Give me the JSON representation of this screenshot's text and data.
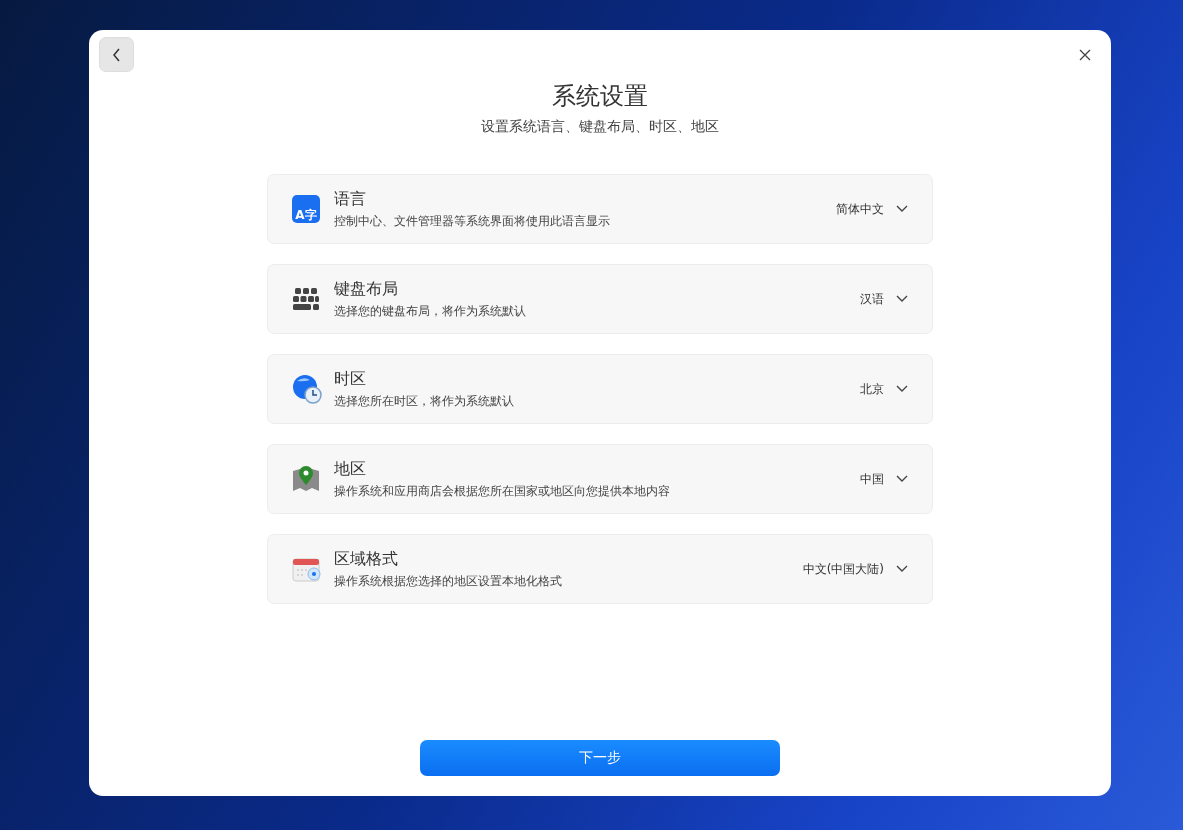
{
  "window": {
    "title": "系统设置",
    "subtitle": "设置系统语言、键盘布局、时区、地区"
  },
  "settings": [
    {
      "kind": "language",
      "icon_text": "A字",
      "title": "语言",
      "description": "控制中心、文件管理器等系统界面将使用此语言显示",
      "value": "简体中文"
    },
    {
      "kind": "keyboard",
      "title": "键盘布局",
      "description": "选择您的键盘布局，将作为系统默认",
      "value": "汉语"
    },
    {
      "kind": "timezone",
      "title": "时区",
      "description": "选择您所在时区，将作为系统默认",
      "value": "北京"
    },
    {
      "kind": "region",
      "title": "地区",
      "description": "操作系统和应用商店会根据您所在国家或地区向您提供本地内容",
      "value": "中国"
    },
    {
      "kind": "format",
      "title": "区域格式",
      "description": "操作系统根据您选择的地区设置本地化格式",
      "value": "中文(中国大陆)"
    }
  ],
  "next_button": "下一步"
}
